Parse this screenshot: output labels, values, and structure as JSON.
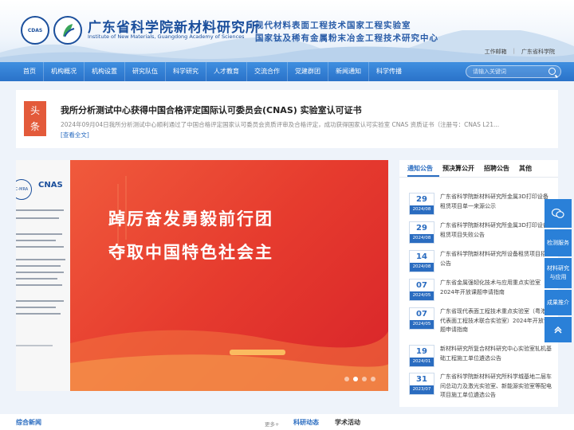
{
  "header": {
    "logo_left": "CDAS",
    "institute_name": "广东省科学院新材料研究所",
    "institute_en": "Institute of New Materials, Guangdong Academy of Sciences",
    "lab_line1": "现代材料表面工程技术国家工程实验室",
    "lab_line2": "国家钛及稀有金属粉末冶金工程技术研究中心",
    "top_links": [
      "工作邮箱",
      "广东省科学院"
    ],
    "top_links_sep": "|"
  },
  "nav": {
    "items": [
      "首页",
      "机构概况",
      "机构设置",
      "研究队伍",
      "科学研究",
      "人才教育",
      "交流合作",
      "党建群团",
      "新闻通知",
      "科学传播"
    ],
    "search_placeholder": "请输入关键词"
  },
  "headline": {
    "badge": [
      "头",
      "条"
    ],
    "title": "我所分析测试中心获得中国合格评定国际认可委员会(CNAS) 实验室认可证书",
    "summary": "2024年09月04日我所分析测试中心顺利通过了中国合格评定国家认可委员会资质评审及合格评定，成功获得国家认可实验室 CNAS 资质证书（注册号：CNAS L21...",
    "more": "[查看全文]"
  },
  "banner": {
    "cert_mra": "C-MRA",
    "cert_logo": "CNAS",
    "slogan_line1": "踔厉奋发勇毅前行团",
    "slogan_line2": "夺取中国特色社会主",
    "dots_total": 4,
    "dot_active": 2
  },
  "notice": {
    "tabs": [
      "通知公告",
      "预决算公开",
      "招聘公告",
      "其他"
    ],
    "active_tab": 0,
    "items": [
      {
        "day": "29",
        "ym": "2024/08",
        "text": "广东省科学院新材料研究所金属3D打印设备租赁项目单一来源公示"
      },
      {
        "day": "29",
        "ym": "2024/08",
        "text": "广东省科学院新材料研究所金属3D打印设备租赁项目失败公告"
      },
      {
        "day": "14",
        "ym": "2024/08",
        "text": "广东省科学院新材料研究所设备租赁项目招标公告"
      },
      {
        "day": "07",
        "ym": "2024/05",
        "text": "广东省金属强韧化技术与应用重点实验室 2024年开放课题申请指南"
      },
      {
        "day": "07",
        "ym": "2024/05",
        "text": "广东省现代表面工程技术重点实验室（粤港现代表面工程技术联合实验室）2024年开放课题申请指南"
      },
      {
        "day": "19",
        "ym": "2024/01",
        "text": "新材料研究所复合材料研究中心实验室轧机基础工程施工单位遴选公告"
      },
      {
        "day": "31",
        "ym": "2023/07",
        "text": "广东省科学院新材料研究所科学城基地二层车间总动力及激光实验室、新能源实验室等配电项目施工单位遴选公告"
      }
    ]
  },
  "sidebar": {
    "items": [
      "检测服务",
      "材料研究与应用",
      "成果推介"
    ]
  },
  "bottom": {
    "left_title": "综合新闻",
    "left_more": "更多+",
    "mid_title": "科研动态",
    "right_title": "学术活动"
  },
  "colors": {
    "primary": "#2a6cc0",
    "nav_bg": "#3583d6",
    "headline_badge": "#e35a3a",
    "banner_red": "#e63b2e"
  }
}
